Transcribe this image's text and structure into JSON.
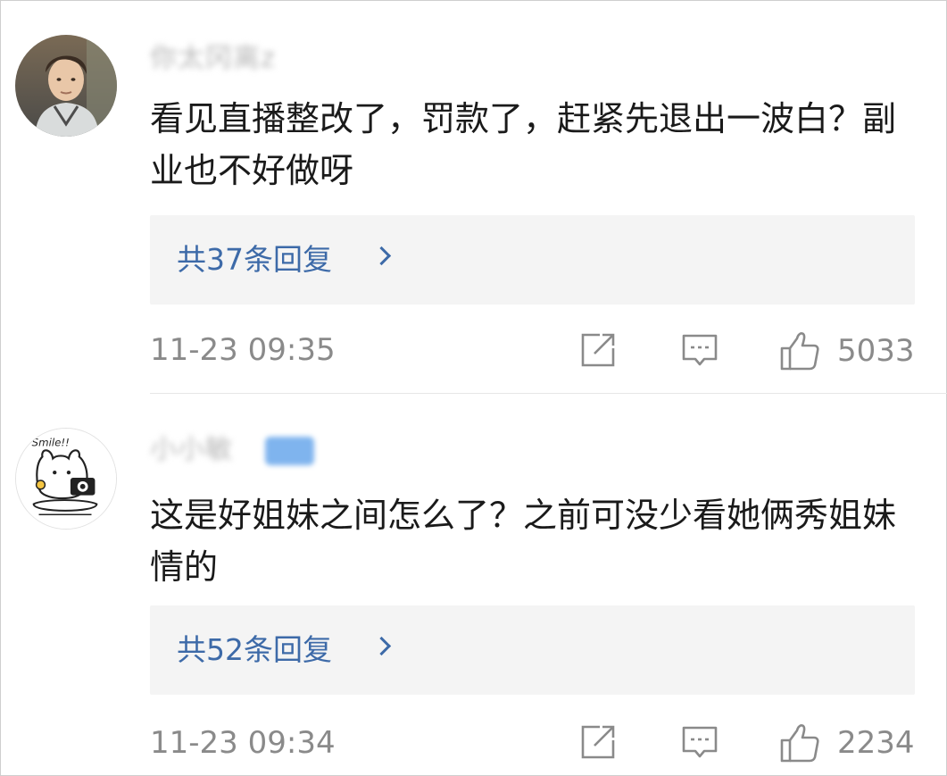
{
  "comments": [
    {
      "username": "你太冈离z",
      "text": "看见直播整改了，罚款了，赶紧先退出一波白？副业也不好做呀",
      "replies_label": "共37条回复",
      "time": "11-23 09:35",
      "likes": "5033",
      "avatar_icon": "user-photo-avatar"
    },
    {
      "username": "小小敏",
      "text": "这是好姐妹之间怎么了？之前可没少看她俩秀姐妹情的",
      "replies_label": "共52条回复",
      "time": "11-23 09:34",
      "likes": "2234",
      "avatar_icon": "cartoon-camera-avatar",
      "avatar_text": "Smile!!"
    }
  ],
  "icons": {
    "share": "share-icon",
    "comment": "comment-icon",
    "like": "thumbs-up-icon",
    "chevron": "chevron-right-icon"
  },
  "colors": {
    "link": "#3d6aa8",
    "meta": "#8a8a8a",
    "reply_bg": "#f4f4f4"
  }
}
